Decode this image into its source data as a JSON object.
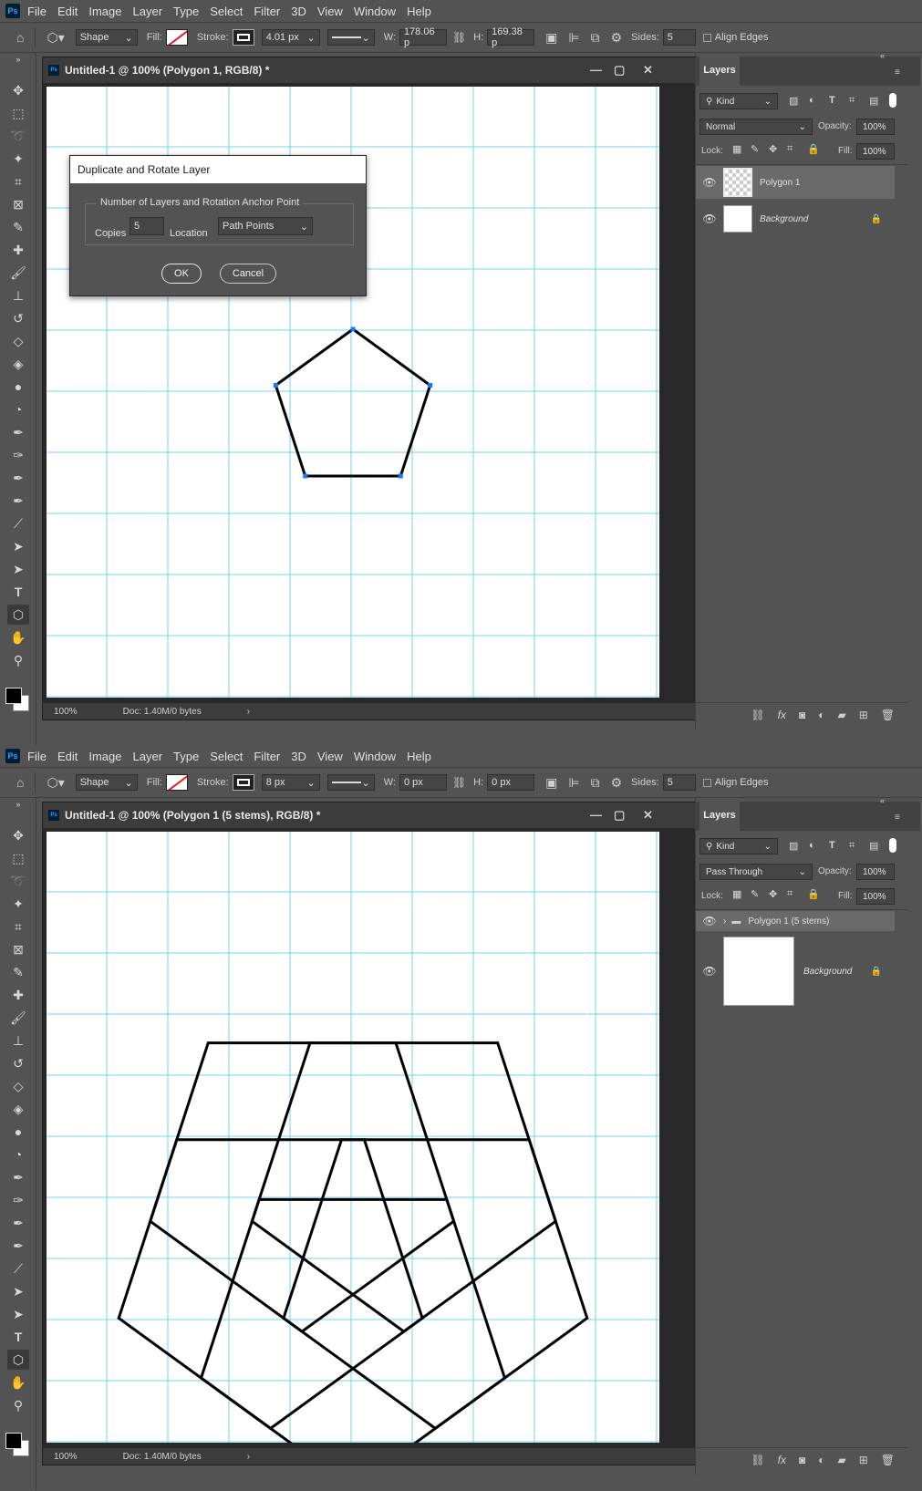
{
  "menu": [
    "File",
    "Edit",
    "Image",
    "Layer",
    "Type",
    "Select",
    "Filter",
    "3D",
    "View",
    "Window",
    "Help"
  ],
  "app_logo": "Ps",
  "top": {
    "options": {
      "shape_mode": "Shape",
      "fill_label": "Fill:",
      "stroke_label": "Stroke:",
      "stroke_width": "4.01 px",
      "w_label": "W:",
      "w_value": "178.06 p",
      "h_label": "H:",
      "h_value": "169.38 p",
      "sides_label": "Sides:",
      "sides_value": "5",
      "align_edges": "Align Edges"
    },
    "document_title": "Untitled-1 @ 100% (Polygon 1, RGB/8) *",
    "zoom": "100%",
    "doc_info": "Doc: 1.40M/0 bytes",
    "dialog": {
      "title": "Duplicate and Rotate Layer",
      "group_label": "Number of Layers and Rotation Anchor Point",
      "copies_label": "Copies",
      "copies_value": "5",
      "location_label": "Location",
      "location_value": "Path Points",
      "ok_label": "OK",
      "cancel_label": "Cancel"
    },
    "layers_panel": {
      "tab": "Layers",
      "filter": "Kind",
      "blend_mode": "Normal",
      "opacity_label": "Opacity:",
      "opacity_value": "100%",
      "lock_label": "Lock:",
      "fill_label": "Fill:",
      "fill_value": "100%",
      "layers": [
        {
          "name": "Polygon 1",
          "selected": true
        },
        {
          "name": "Background",
          "locked": true
        }
      ]
    }
  },
  "bottom": {
    "options": {
      "shape_mode": "Shape",
      "fill_label": "Fill:",
      "stroke_label": "Stroke:",
      "stroke_width": "8 px",
      "w_label": "W:",
      "w_value": "0 px",
      "h_label": "H:",
      "h_value": "0 px",
      "sides_label": "Sides:",
      "sides_value": "5",
      "align_edges": "Align Edges"
    },
    "document_title": "Untitled-1 @ 100% (Polygon 1 (5 stems), RGB/8) *",
    "zoom": "100%",
    "doc_info": "Doc: 1.40M/0 bytes",
    "layers_panel": {
      "tab": "Layers",
      "filter": "Kind",
      "blend_mode": "Pass Through",
      "opacity_label": "Opacity:",
      "opacity_value": "100%",
      "lock_label": "Lock:",
      "fill_label": "Fill:",
      "fill_value": "100%",
      "layers": [
        {
          "name": "Polygon 1 (5 stems)",
          "group": true,
          "selected": true
        },
        {
          "name": "Background",
          "locked": true
        }
      ]
    }
  },
  "colors": {
    "ui_bg": "#535353",
    "ui_dark": "#3c3c3c",
    "canvas_bg": "#ffffff",
    "guide": "#6fd6e6",
    "anchor": "#1e73ff",
    "stroke": "#000000"
  }
}
